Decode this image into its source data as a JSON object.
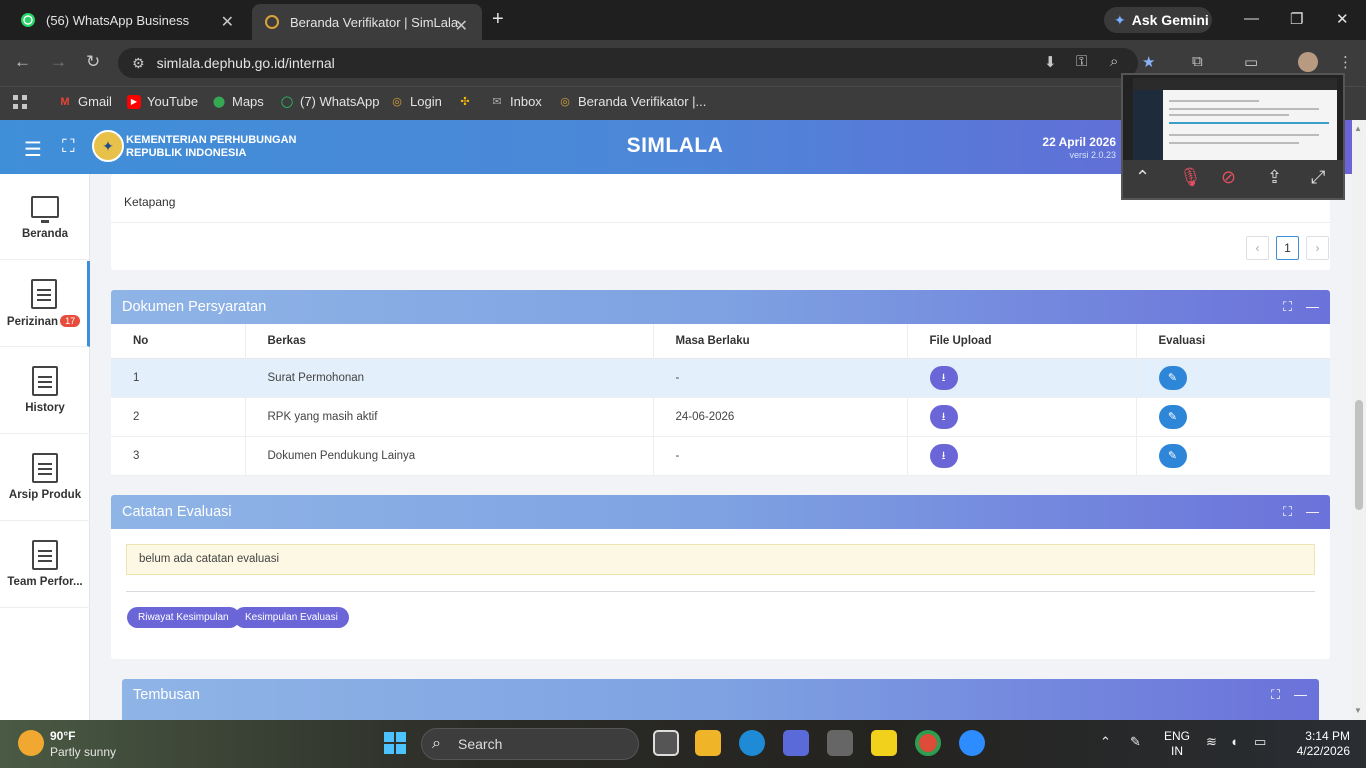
{
  "browser": {
    "tabs": [
      {
        "title": "(56) WhatsApp Business",
        "active": false
      },
      {
        "title": "Beranda Verifikator | SimLala",
        "active": true
      }
    ],
    "gemini_label": "Ask Gemini",
    "url": "simlala.dephub.go.id/internal",
    "bookmarks": [
      "Gmail",
      "YouTube",
      "Maps",
      "(7) WhatsApp",
      "Login",
      "Inbox",
      "Beranda Verifikator |..."
    ]
  },
  "header": {
    "org_line1": "KEMENTERIAN PERHUBUNGAN",
    "org_line2": "REPUBLIK INDONESIA",
    "title": "SIMLALA",
    "date": "22 April 2026",
    "version": "versi 2.0.23"
  },
  "sidebar": {
    "items": [
      {
        "label": "Beranda"
      },
      {
        "label": "Perizinan",
        "badge": "17"
      },
      {
        "label": "History"
      },
      {
        "label": "Arsip Produk"
      },
      {
        "label": "Team Perfor..."
      }
    ]
  },
  "top_card": {
    "text": "Ketapang",
    "pager": {
      "prev": "‹",
      "page": "1",
      "next": "›"
    }
  },
  "dokumen": {
    "title": "Dokumen Persyaratan",
    "columns": [
      "No",
      "Berkas",
      "Masa Berlaku",
      "File Upload",
      "Evaluasi"
    ],
    "rows": [
      {
        "no": "1",
        "berkas": "Surat Permohonan",
        "masa": "-"
      },
      {
        "no": "2",
        "berkas": "RPK yang masih aktif",
        "masa": "24-06-2026"
      },
      {
        "no": "3",
        "berkas": "Dokumen Pendukung Lainya",
        "masa": "-"
      }
    ]
  },
  "catatan": {
    "title": "Catatan Evaluasi",
    "note": "belum ada catatan evaluasi",
    "buttons": [
      "Riwayat Kesimpulan",
      "Kesimpulan Evaluasi"
    ]
  },
  "tembusan": {
    "title": "Tembusan"
  },
  "taskbar": {
    "temp": "90°F",
    "weather": "Partly sunny",
    "search": "Search",
    "lang1": "ENG",
    "lang2": "IN",
    "time": "3:14 PM",
    "date": "4/22/2026"
  },
  "colors": {
    "header_start": "#3f8fd8",
    "header_end": "#6b63d6",
    "download_button": "#6a66d8",
    "edit_button": "#2e86d8",
    "badge": "#e74c3c"
  }
}
